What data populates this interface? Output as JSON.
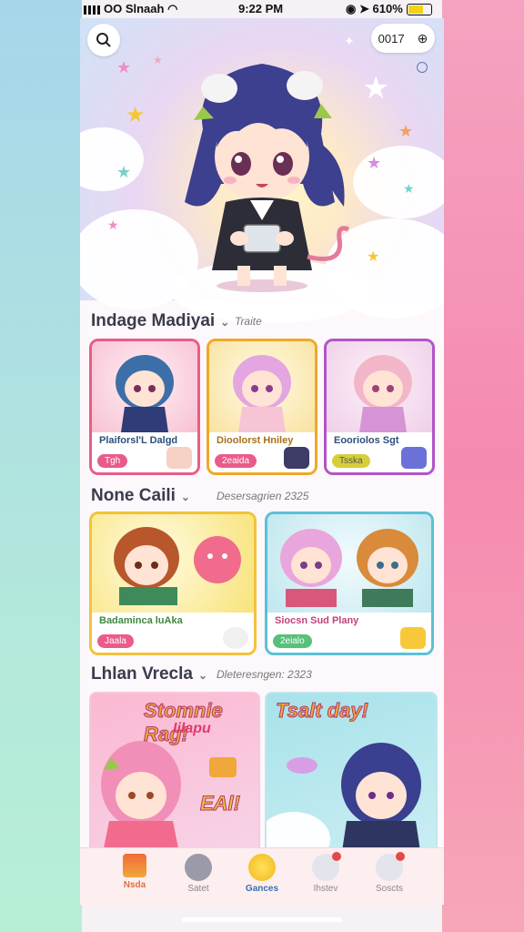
{
  "status_bar": {
    "carrier": "OO Slnaah",
    "time": "9:22 PM",
    "battery": "610%"
  },
  "header": {
    "counter": "0017",
    "search_icon": "search-icon",
    "settings_icon": "pin-icon"
  },
  "sections": [
    {
      "title": "Indage Madiyai",
      "subtitle": "Traite",
      "cards": [
        {
          "title": "Plaiforsl'L Dalgd",
          "tag": "Tgh",
          "color": "#e95c8a"
        },
        {
          "title": "Dioolorst Hniley",
          "tag": "2eaida",
          "color": "#f0a828"
        },
        {
          "title": "Eooriolos Sgt",
          "tag": "Tsska",
          "color": "#b055c8"
        }
      ]
    },
    {
      "title": "None Caili",
      "subtitle": "Desersagrien 2325",
      "cards": [
        {
          "title": "Badaminca luAka",
          "tag": "Jaala",
          "color": "#f2c23a"
        },
        {
          "title": "Siocsn Sud Plany",
          "tag": "2eialo",
          "color": "#5cc0d6"
        }
      ]
    },
    {
      "title": "Lhlan Vrecla",
      "subtitle": "Dleteresngen: 2323",
      "promos": [
        {
          "title": "Stomnie Rag!",
          "subtitle": "Iilapu",
          "extra": "EAl!"
        },
        {
          "title": "Tsalt day!"
        }
      ]
    }
  ],
  "nav": [
    {
      "label": "Nsda",
      "icon": "home-icon",
      "active": true
    },
    {
      "label": "Satet",
      "icon": "compass-icon"
    },
    {
      "label": "Gances",
      "icon": "coin-icon"
    },
    {
      "label": "Ihstev",
      "icon": "chat-icon"
    },
    {
      "label": "Soscts",
      "icon": "friends-icon"
    }
  ]
}
